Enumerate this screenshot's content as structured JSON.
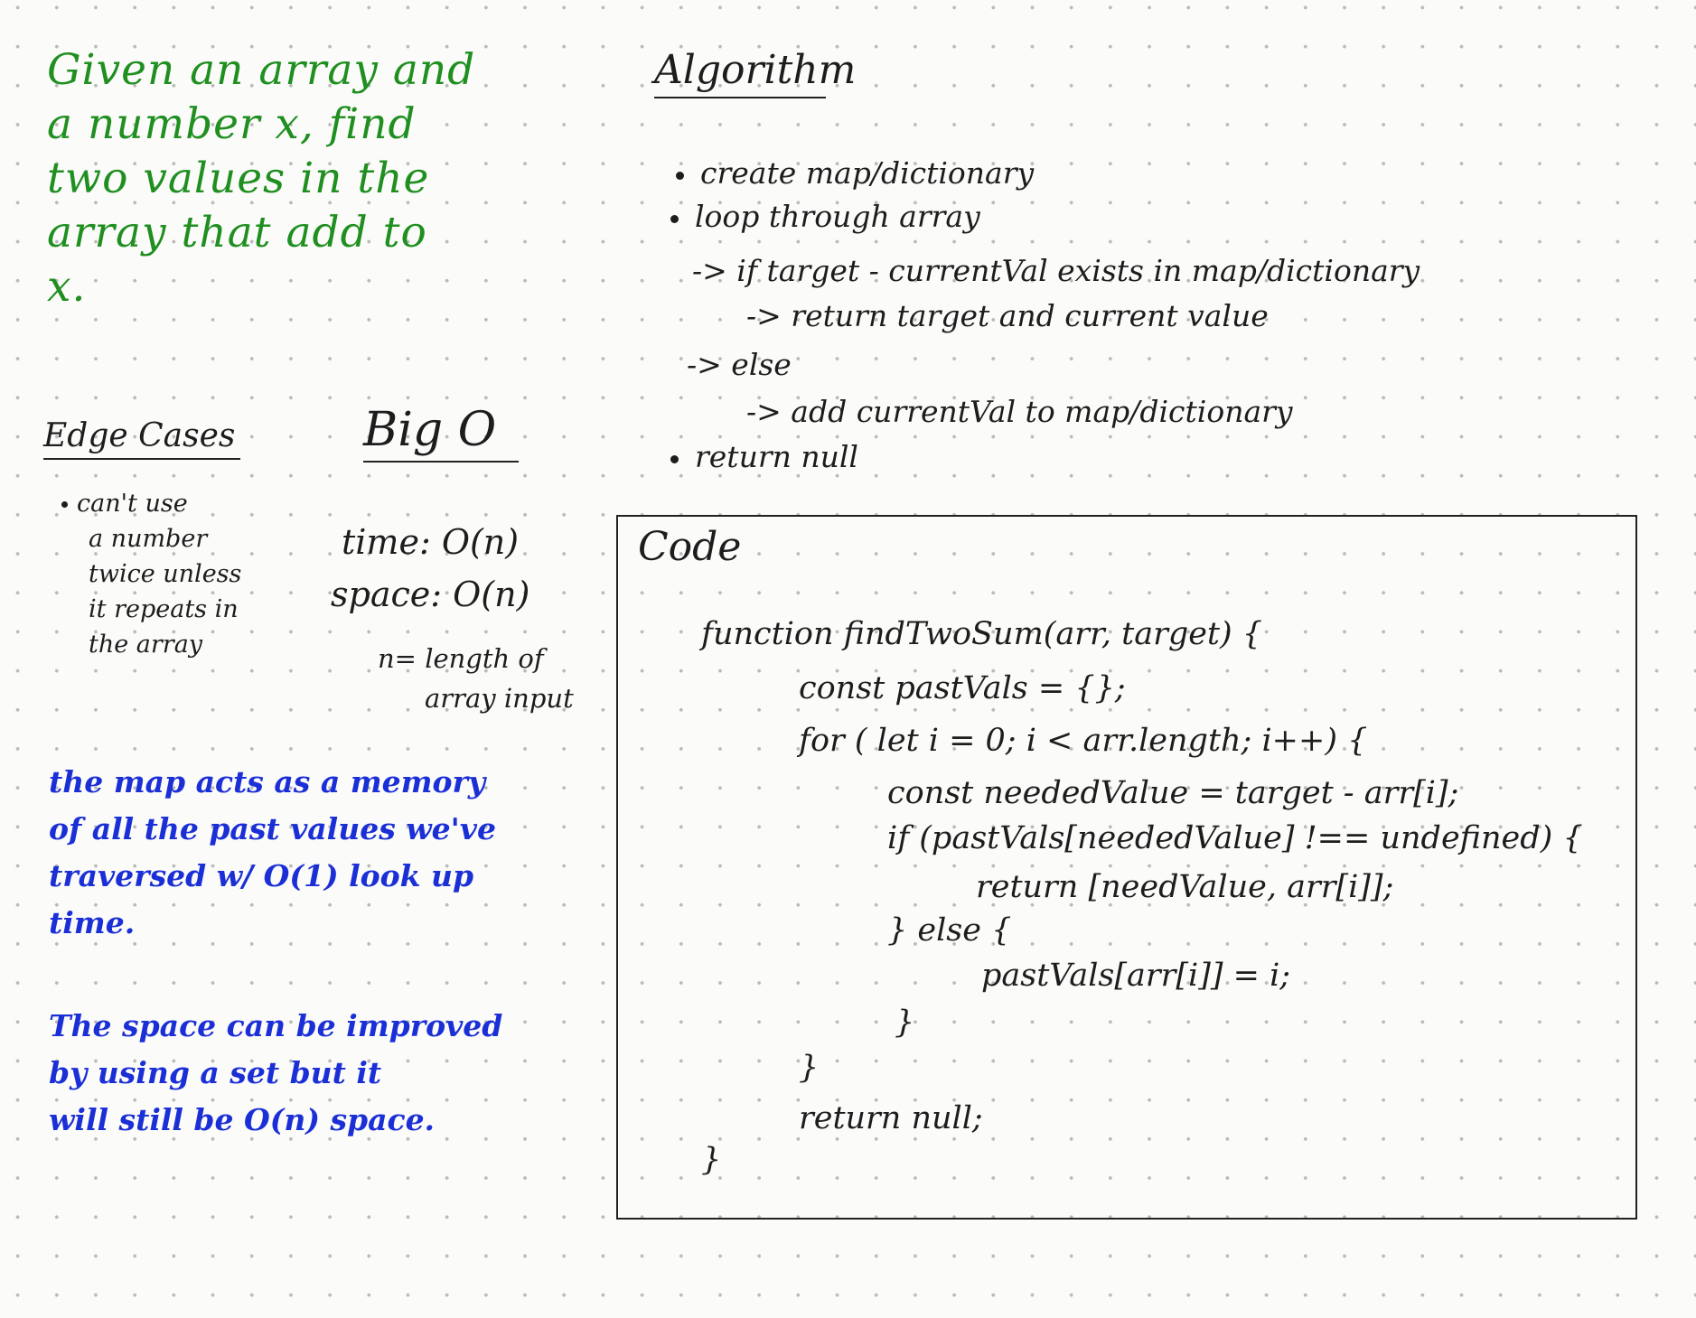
{
  "problem": {
    "lines": [
      "Given an array and",
      "a number x, find",
      "two values in the",
      "array that add to",
      "x."
    ]
  },
  "algorithm": {
    "heading": "Algorithm",
    "steps": [
      "create map/dictionary",
      "loop through array",
      "-> if target - currentVal exists in map/dictionary",
      "-> return target and current value",
      "-> else",
      "-> add currentVal to map/dictionary",
      "return null"
    ]
  },
  "edge_cases": {
    "heading": "Edge Cases",
    "lines": [
      "can't use",
      "a number",
      "twice unless",
      "it repeats in",
      "the array"
    ]
  },
  "big_o": {
    "heading": "Big O",
    "time": "time: O(n)",
    "space": "space: O(n)",
    "n_def_1": "n= length of",
    "n_def_2": "array input"
  },
  "notes": {
    "map_note": [
      "the map acts as a memory",
      "of all the past values we've",
      "traversed w/ O(1) look up",
      "time."
    ],
    "space_note": [
      "The space can be improved",
      "by using a set but it",
      "will still be O(n) space."
    ]
  },
  "code": {
    "title": "Code",
    "lines": [
      "function findTwoSum(arr, target) {",
      "const pastVals = {};",
      "for ( let i = 0; i < arr.length; i++) {",
      "const neededValue = target - arr[i];",
      "if (pastVals[neededValue] !== undefined) {",
      "return [needValue, arr[i]];",
      "} else {",
      "pastVals[arr[i]] = i;",
      "}",
      "}",
      "return null;",
      "}"
    ]
  },
  "colors": {
    "problem_text": "#1f8f1f",
    "note_text": "#1b2fd6",
    "ink": "#1d1d1d",
    "background": "#fbfbfa"
  }
}
